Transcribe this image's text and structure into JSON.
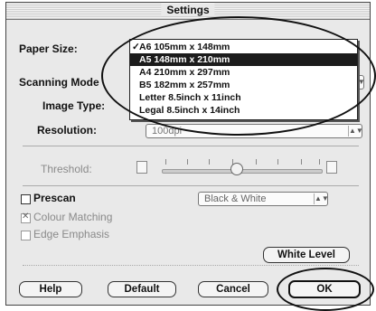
{
  "window": {
    "title": "Settings"
  },
  "paper_size": {
    "label": "Paper Size:",
    "menu_items": [
      {
        "label": "A6 105mm x 148mm",
        "checked": true,
        "selected": false
      },
      {
        "label": "A5 148mm x 210mm",
        "checked": false,
        "selected": true
      },
      {
        "label": "A4 210mm x 297mm",
        "checked": false,
        "selected": false
      },
      {
        "label": "B5 182mm x 257mm",
        "checked": false,
        "selected": false
      },
      {
        "label": "Letter 8.5inch x 11inch",
        "checked": false,
        "selected": false
      },
      {
        "label": "Legal 8.5inch x 14inch",
        "checked": false,
        "selected": false
      }
    ],
    "check_glyph": "✓"
  },
  "scanning_mode": {
    "label": "Scanning Mode"
  },
  "image_type": {
    "label": "Image Type:"
  },
  "resolution": {
    "label": "Resolution:",
    "value": "100dpi"
  },
  "threshold": {
    "label": "Threshold:",
    "position_fraction": 0.45
  },
  "prescan": {
    "label": "Prescan",
    "checked": false,
    "mode_value": "Black & White"
  },
  "colour_matching": {
    "label": "Colour Matching",
    "checked": true,
    "enabled": false
  },
  "edge_emphasis": {
    "label": "Edge Emphasis",
    "checked": false,
    "enabled": false
  },
  "buttons": {
    "white_level": "White Level",
    "help": "Help",
    "default": "Default",
    "cancel": "Cancel",
    "ok": "OK"
  },
  "colors": {
    "menu_highlight": "#1c1c1c",
    "dialog_bg": "#e9e9e9"
  }
}
